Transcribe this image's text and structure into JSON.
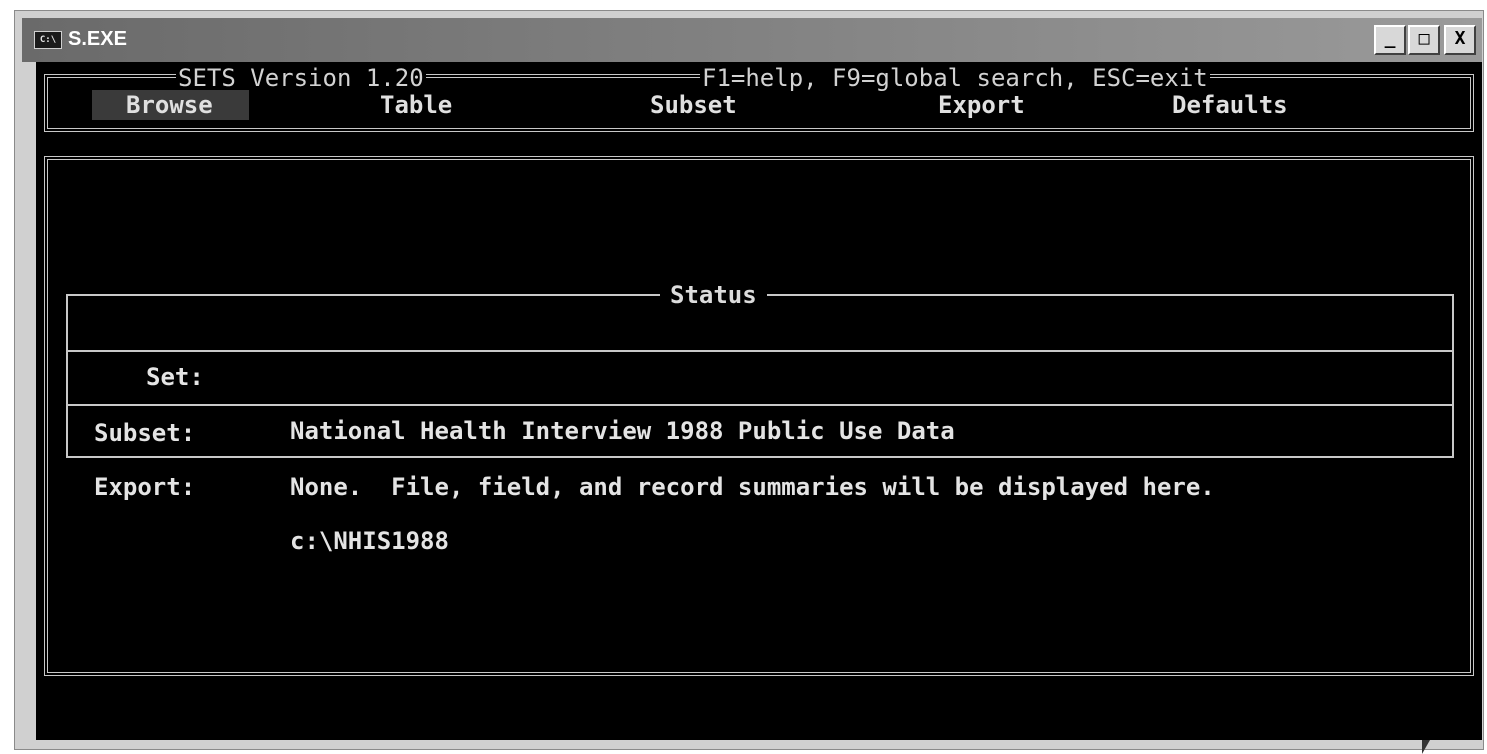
{
  "window": {
    "icon_label": "C:\\",
    "title": "S.EXE",
    "buttons": {
      "minimize": "_",
      "maximize": "□",
      "close": "X"
    }
  },
  "app": {
    "header_left": "SETS Version 1.20",
    "header_right": "F1=help, F9=global search, ESC=exit",
    "menu": {
      "browse": "Browse",
      "table": "Table",
      "subset": "Subset",
      "export": "Export",
      "defaults": "Defaults"
    },
    "selected_menu": "Browse"
  },
  "status": {
    "title": "Status",
    "rows": [
      {
        "label": "Set:",
        "value": "National Health Interview 1988 Public Use Data"
      },
      {
        "label": "Subset:",
        "value": "None.  File, field, and record summaries will be displayed here."
      },
      {
        "label": "Export:",
        "value": "c:\\NHIS1988"
      }
    ]
  },
  "colors": {
    "console_bg": "#000000",
    "console_text": "#e0e0e0",
    "titlebar": "#7a7a7a",
    "selected_menu_bg": "#3a3a3a"
  }
}
